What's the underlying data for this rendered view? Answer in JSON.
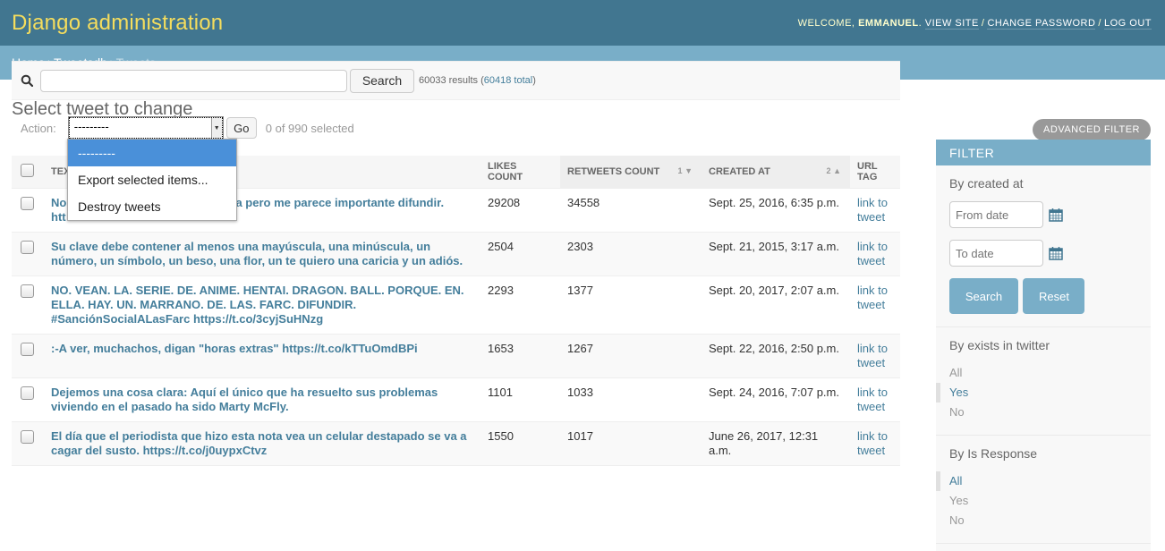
{
  "header": {
    "branding": "Django administration",
    "welcome": "Welcome,",
    "user": "Emmanuel",
    "links": [
      "View site",
      "Change password",
      "Log out"
    ]
  },
  "breadcrumbs": [
    "Home",
    "Tweetsdb",
    "Tweets"
  ],
  "page_title": "Select tweet to change",
  "advanced_filter": "Advanced filter",
  "search": {
    "value": "",
    "button": "Search",
    "results": "60033 results",
    "total": "60418 total"
  },
  "actions": {
    "label": "Action:",
    "selected_value": "---------",
    "options": [
      "---------",
      "Export selected items...",
      "Destroy tweets"
    ],
    "go": "Go",
    "counter": "0 of 990 selected"
  },
  "table": {
    "columns": [
      {
        "label": "Text"
      },
      {
        "label": "Likes count"
      },
      {
        "label": "Retweets count",
        "sort_priority": "1",
        "sort_dir": "desc"
      },
      {
        "label": "Created at",
        "sort_priority": "2",
        "sort_dir": "asc"
      },
      {
        "label": "URL tag"
      }
    ],
    "rows": [
      {
        "text_start": "No",
        "text_visible": "paña pero me parece importante difundir.",
        "text_line2": "htt",
        "likes": "29208",
        "retweets": "34558",
        "created": "Sept. 25, 2016, 6:35 p.m.",
        "link": "link to tweet"
      },
      {
        "text": "Su clave debe contener al menos una mayúscula, una minúscula, un número, un símbolo, un beso, una flor, un te quiero una caricia y un adiós.",
        "likes": "2504",
        "retweets": "2303",
        "created": "Sept. 21, 2015, 3:17 a.m.",
        "link": "link to tweet"
      },
      {
        "text": "NO. VEAN. LA. SERIE. DE. ANIME. HENTAI. DRAGON. BALL. PORQUE. EN. ELLA. HAY. UN. MARRANO. DE. LAS. FARC. DIFUNDIR. #SanciónSocialALasFarc https://t.co/3cyjSuHNzg",
        "likes": "2293",
        "retweets": "1377",
        "created": "Sept. 20, 2017, 2:07 a.m.",
        "link": "link to tweet"
      },
      {
        "text": ":-A ver, muchachos, digan \"horas extras\" https://t.co/kTTuOmdBPi",
        "likes": "1653",
        "retweets": "1267",
        "created": "Sept. 22, 2016, 2:50 p.m.",
        "link": "link to tweet"
      },
      {
        "text": "Dejemos una cosa clara: Aquí el único que ha resuelto sus problemas viviendo en el pasado ha sido Marty McFly.",
        "likes": "1101",
        "retweets": "1033",
        "created": "Sept. 24, 2016, 7:07 p.m.",
        "link": "link to tweet"
      },
      {
        "text": "El día que el periodista que hizo esta nota vea un celular destapado se va a cagar del susto. https://t.co/j0uypxCtvz",
        "likes": "1550",
        "retweets": "1017",
        "created": "June 26, 2017, 12:31 a.m.",
        "link": "link to tweet"
      }
    ]
  },
  "filter": {
    "title": "Filter",
    "created_at": {
      "title": "By created at",
      "from_placeholder": "From date",
      "to_placeholder": "To date",
      "search": "Search",
      "reset": "Reset"
    },
    "exists": {
      "title": "By exists in twitter",
      "options": [
        "All",
        "Yes",
        "No"
      ],
      "selected": "Yes"
    },
    "is_response": {
      "title": "By Is Response",
      "options": [
        "All",
        "Yes",
        "No"
      ],
      "selected": "All"
    }
  },
  "colors": {
    "header_bg": "#417690",
    "branding": "#f5dd5d",
    "breadcrumbs_bg": "#79aec8",
    "link": "#447e9b",
    "dropdown_highlight": "#4a90d9"
  }
}
